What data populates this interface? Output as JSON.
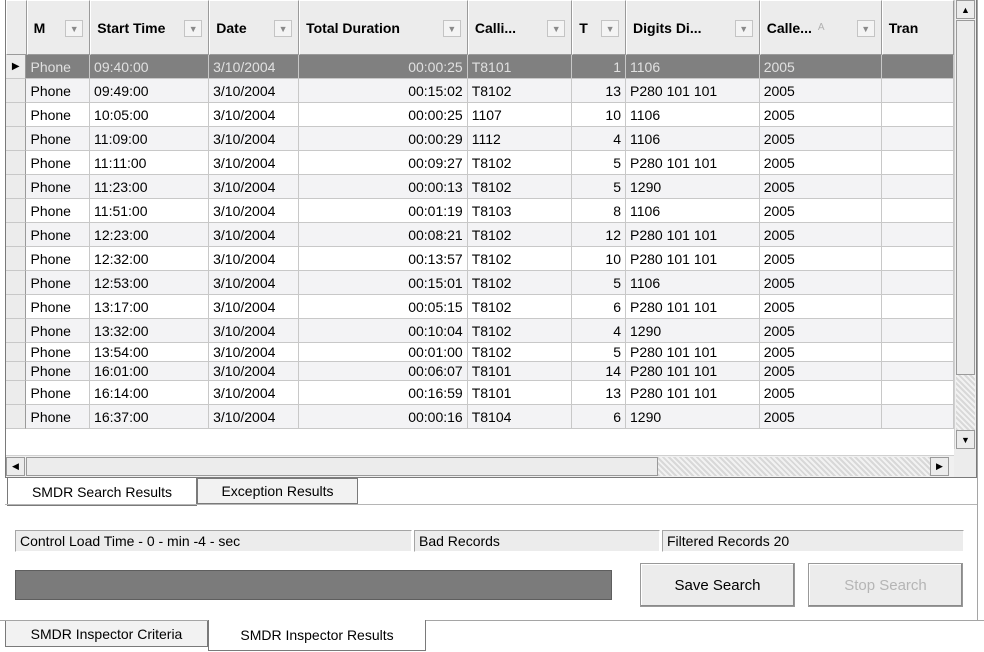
{
  "columns": [
    {
      "label": "M",
      "sort": ""
    },
    {
      "label": "Start Time",
      "sort": ""
    },
    {
      "label": "Date",
      "sort": ""
    },
    {
      "label": "Total Duration",
      "sort": ""
    },
    {
      "label": "Calli...",
      "sort": ""
    },
    {
      "label": "T",
      "sort": ""
    },
    {
      "label": "Digits Di...",
      "sort": ""
    },
    {
      "label": "Calle...",
      "sort": "A"
    },
    {
      "label": "Tran",
      "sort": ""
    }
  ],
  "rows": [
    [
      "Phone",
      "09:40:00",
      "3/10/2004",
      "00:00:25",
      "T8101",
      "1",
      "1106",
      "2005",
      ""
    ],
    [
      "Phone",
      "09:49:00",
      "3/10/2004",
      "00:15:02",
      "T8102",
      "13",
      "P280 101 101",
      "2005",
      ""
    ],
    [
      "Phone",
      "10:05:00",
      "3/10/2004",
      "00:00:25",
      "1107",
      "10",
      "1106",
      "2005",
      ""
    ],
    [
      "Phone",
      "11:09:00",
      "3/10/2004",
      "00:00:29",
      "1112",
      "4",
      "1106",
      "2005",
      ""
    ],
    [
      "Phone",
      "11:11:00",
      "3/10/2004",
      "00:09:27",
      "T8102",
      "5",
      "P280 101 101",
      "2005",
      ""
    ],
    [
      "Phone",
      "11:23:00",
      "3/10/2004",
      "00:00:13",
      "T8102",
      "5",
      "1290",
      "2005",
      ""
    ],
    [
      "Phone",
      "11:51:00",
      "3/10/2004",
      "00:01:19",
      "T8103",
      "8",
      "1106",
      "2005",
      ""
    ],
    [
      "Phone",
      "12:23:00",
      "3/10/2004",
      "00:08:21",
      "T8102",
      "12",
      "P280 101 101",
      "2005",
      ""
    ],
    [
      "Phone",
      "12:32:00",
      "3/10/2004",
      "00:13:57",
      "T8102",
      "10",
      "P280 101 101",
      "2005",
      ""
    ],
    [
      "Phone",
      "12:53:00",
      "3/10/2004",
      "00:15:01",
      "T8102",
      "5",
      "1106",
      "2005",
      ""
    ],
    [
      "Phone",
      "13:17:00",
      "3/10/2004",
      "00:05:15",
      "T8102",
      "6",
      "P280 101 101",
      "2005",
      ""
    ],
    [
      "Phone",
      "13:32:00",
      "3/10/2004",
      "00:10:04",
      "T8102",
      "4",
      "1290",
      "2005",
      ""
    ],
    [
      "Phone",
      "13:54:00",
      "3/10/2004",
      "00:01:00",
      "T8102",
      "5",
      "P280 101 101",
      "2005",
      ""
    ],
    [
      "Phone",
      "16:01:00",
      "3/10/2004",
      "00:06:07",
      "T8101",
      "14",
      "P280 101 101",
      "2005",
      ""
    ],
    [
      "Phone",
      "16:14:00",
      "3/10/2004",
      "00:16:59",
      "T8101",
      "13",
      "P280 101 101",
      "2005",
      ""
    ],
    [
      "Phone",
      "16:37:00",
      "3/10/2004",
      "00:00:16",
      "T8104",
      "6",
      "1290",
      "2005",
      ""
    ]
  ],
  "result_tabs": {
    "search": "SMDR Search Results",
    "exception": "Exception Results"
  },
  "status": {
    "load_time": "Control Load Time - 0 - min -4 - sec",
    "bad_records": "Bad Records",
    "filtered_records": "Filtered Records 20"
  },
  "buttons": {
    "save": "Save Search",
    "stop": "Stop Search"
  },
  "bottom_tabs": {
    "criteria": "SMDR Inspector Criteria",
    "results": "SMDR Inspector Results"
  },
  "icons": {
    "selected_row": "row-pointer-icon",
    "dropdown": "dropdown-arrow-icon"
  }
}
